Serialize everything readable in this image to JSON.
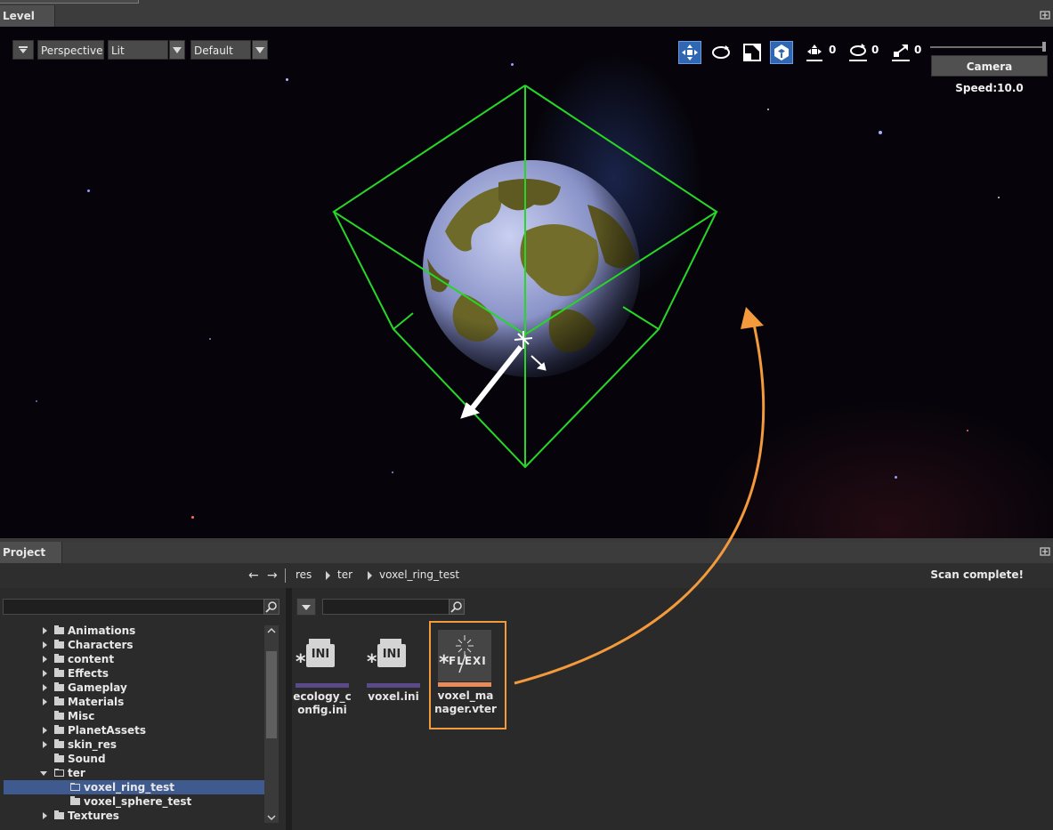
{
  "level_panel": {
    "tab_label": "Level"
  },
  "viewport": {
    "view_mode": "Perspective",
    "lighting_mode": "Lit",
    "preset": "Default",
    "translate_snap": "0",
    "rotate_snap": "0",
    "scale_snap": "0",
    "camera_speed": "Camera Speed:10.0",
    "accent_color": "#2f67b3",
    "selection_color": "#27d627"
  },
  "project_panel": {
    "tab_label": "Project",
    "breadcrumbs": [
      "res",
      "ter",
      "voxel_ring_test"
    ],
    "status": "Scan complete!",
    "tree": [
      {
        "label": "Animations"
      },
      {
        "label": "Characters"
      },
      {
        "label": "content"
      },
      {
        "label": "Effects"
      },
      {
        "label": "Gameplay"
      },
      {
        "label": "Materials"
      },
      {
        "label": "Misc"
      },
      {
        "label": "PlanetAssets"
      },
      {
        "label": "skin_res"
      },
      {
        "label": "Sound"
      },
      {
        "label": "ter"
      },
      {
        "label": "voxel_ring_test"
      },
      {
        "label": "voxel_sphere_test"
      },
      {
        "label": "Textures"
      }
    ],
    "assets": [
      {
        "icon_text": "INI",
        "name": "ecology_config.ini",
        "line1": "ecology_c",
        "line2": "onfig.ini",
        "bar_color": "#5a4a8a"
      },
      {
        "icon_text": "INI",
        "name": "voxel.ini",
        "line1": "voxel.ini",
        "line2": "",
        "bar_color": "#5a4a8a"
      },
      {
        "icon_text": "FLEXI",
        "name": "voxel_manager.vter",
        "line1": "voxel_ma",
        "line2": "nager.vter",
        "bar_color": "#e88a5a"
      }
    ],
    "highlight_color": "#f39a3c"
  }
}
